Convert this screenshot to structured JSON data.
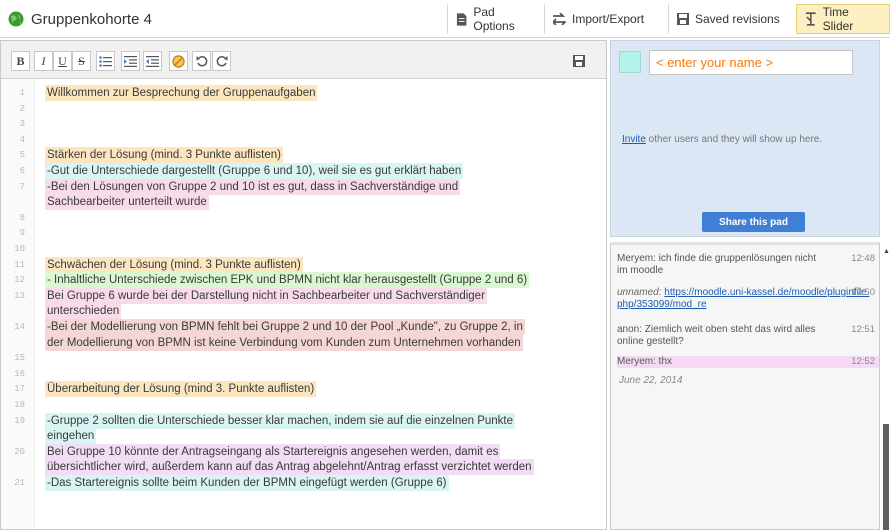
{
  "header": {
    "title": "Gruppenkohorte 4",
    "pad_options": "Pad Options",
    "import_export": "Import/Export",
    "saved_revisions": "Saved revisions",
    "time_slider": "Time Slider"
  },
  "toolbar": {
    "bold": "B",
    "italic": "I",
    "underline": "U",
    "strike": "S"
  },
  "lines": [
    {
      "n": "1",
      "text": "Willkommen zur Besprechung der Gruppenaufgaben",
      "color": "y"
    },
    {
      "n": "2",
      "text": "",
      "color": ""
    },
    {
      "n": "3",
      "text": "",
      "color": ""
    },
    {
      "n": "4",
      "text": "",
      "color": ""
    },
    {
      "n": "5",
      "text": "Stärken der Lösung (mind. 3 Punkte auflisten)",
      "color": "y"
    },
    {
      "n": "6",
      "text": "-Gut die Unterschiede dargestellt (Gruppe 6 und 10), weil sie es gut erklärt haben",
      "color": "c"
    },
    {
      "n": "7",
      "text": "-Bei den Lösungen von Gruppe 2 und 10 ist es gut, dass in Sachverständige und",
      "color": "p"
    },
    {
      "n": "",
      "text": "Sachbearbeiter  unterteilt wurde",
      "color": "p"
    },
    {
      "n": "8",
      "text": "",
      "color": ""
    },
    {
      "n": "9",
      "text": "",
      "color": ""
    },
    {
      "n": "10",
      "text": "",
      "color": ""
    },
    {
      "n": "11",
      "text": "Schwächen der Lösung (mind. 3 Punkte auflisten)",
      "color": "y"
    },
    {
      "n": "12",
      "text": "- Inhaltliche Unterschiede zwischen EPK und BPMN nicht klar herausgestellt (Gruppe 2 und 6)",
      "color": "g"
    },
    {
      "n": "13",
      "text": "Bei Gruppe 6 wurde bei der Darstellung nicht in Sachbearbeiter und Sachverständiger",
      "color": "p"
    },
    {
      "n": "",
      "text": "unterschieden",
      "color": "p"
    },
    {
      "n": "14",
      "text": "-Bei der Modellierung von BPMN fehlt bei Gruppe 2 und 10 der Pool „Kunde\", zu Gruppe 2, in",
      "color": "r"
    },
    {
      "n": "",
      "text": "der Modellierung von BPMN ist keine Verbindung vom Kunden zum Unternehmen vorhanden",
      "color": "r"
    },
    {
      "n": "15",
      "text": "",
      "color": ""
    },
    {
      "n": "16",
      "text": "",
      "color": ""
    },
    {
      "n": "17",
      "text": "Überarbeitung der Lösung (mind 3. Punkte auflisten)",
      "color": "y"
    },
    {
      "n": "18",
      "text": "",
      "color": ""
    },
    {
      "n": "19",
      "text": "-Gruppe 2 sollten die Unterschiede besser klar machen, indem sie auf die einzelnen Punkte",
      "color": "c"
    },
    {
      "n": "",
      "text": "eingehen",
      "color": "c"
    },
    {
      "n": "20",
      "text": "Bei Gruppe 10 könnte der Antragseingang als Startereignis angesehen werden, damit es",
      "color": "v"
    },
    {
      "n": "",
      "text": "übersichtlicher wird, außerdem kann auf das Antrag abgelehnt/Antrag erfasst verzichtet werden",
      "color": "v"
    },
    {
      "n": "21",
      "text": "-Das Startereignis  sollte beim Kunden der BPMN eingefügt werden (Gruppe 6)",
      "color": "c"
    }
  ],
  "users": {
    "name_placeholder": "< enter your name >",
    "invite_link": "Invite",
    "invite_text": " other users and they will show up here.",
    "share_button": "Share this pad"
  },
  "chat": {
    "messages": [
      {
        "text": "Meryem: ich finde die gruppenlösungen nicht im moodle",
        "time": "12:48"
      },
      {
        "author": "unnamed:",
        "link": "https://moodle.uni-kassel.de/moodle/pluginfile.php/353099/mod_re",
        "time": "12:50"
      },
      {
        "text": "anon: Ziemlich weit oben steht das wird alles online gestellt?",
        "time": "12:51"
      },
      {
        "text": "Meryem: thx",
        "time": "12:52"
      }
    ],
    "date": "June 22, 2014"
  },
  "colors": {
    "my_user_color": "#b3f2eb",
    "share_button": "#3f7fd6",
    "time_slider_active": "#fcefc2"
  }
}
